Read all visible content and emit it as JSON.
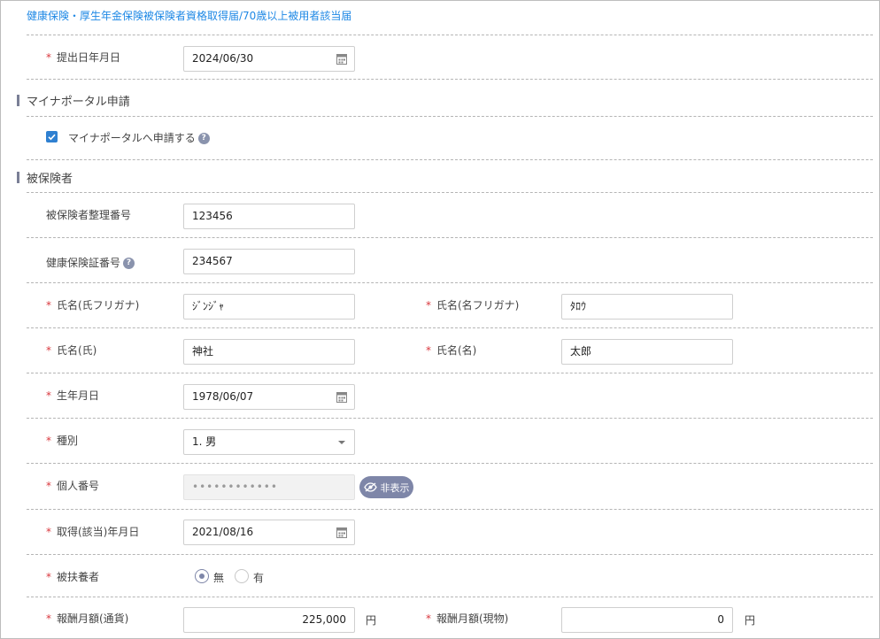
{
  "breadcrumb": "健康保険・厚生年金保険被保険者資格取得届/70歳以上被用者該当届",
  "submission": {
    "label": "提出日年月日",
    "value": "2024/06/30"
  },
  "myna": {
    "title": "マイナポータル申請",
    "checkbox_label": "マイナポータルへ申請する",
    "checked": true
  },
  "insured": {
    "title": "被保険者",
    "mgmt_no": {
      "label": "被保険者整理番号",
      "value": "123456"
    },
    "card_no": {
      "label": "健康保険証番号",
      "value": "234567"
    },
    "kana_last": {
      "label": "氏名(氏フリガナ)",
      "value": "ｼﾞﾝｼﾞｬ"
    },
    "kana_first": {
      "label": "氏名(名フリガナ)",
      "value": "ﾀﾛｳ"
    },
    "name_last": {
      "label": "氏名(氏)",
      "value": "神社"
    },
    "name_first": {
      "label": "氏名(名)",
      "value": "太郎"
    },
    "birth": {
      "label": "生年月日",
      "value": "1978/06/07"
    },
    "gender": {
      "label": "種別",
      "value": "1. 男"
    },
    "my_number": {
      "label": "個人番号",
      "value": "••••••••••••",
      "toggle_label": "非表示"
    },
    "acquire_date": {
      "label": "取得(該当)年月日",
      "value": "2021/08/16"
    },
    "dependent": {
      "label": "被扶養者",
      "option_no": "無",
      "option_yes": "有",
      "selected": "無"
    },
    "salary_cash": {
      "label": "報酬月額(通貨)",
      "value": "225,000",
      "unit": "円"
    },
    "salary_kind": {
      "label": "報酬月額(現物)",
      "value": "0",
      "unit": "円"
    }
  },
  "help_glyph": "?",
  "colors": {
    "accent": "#7e86a8",
    "link": "#1e88e5",
    "required": "#d9383e",
    "checkbox": "#2f80d1"
  },
  "icons": [
    "calendar-icon",
    "help-icon",
    "eye-off-icon",
    "chevron-down-icon",
    "check-icon"
  ]
}
